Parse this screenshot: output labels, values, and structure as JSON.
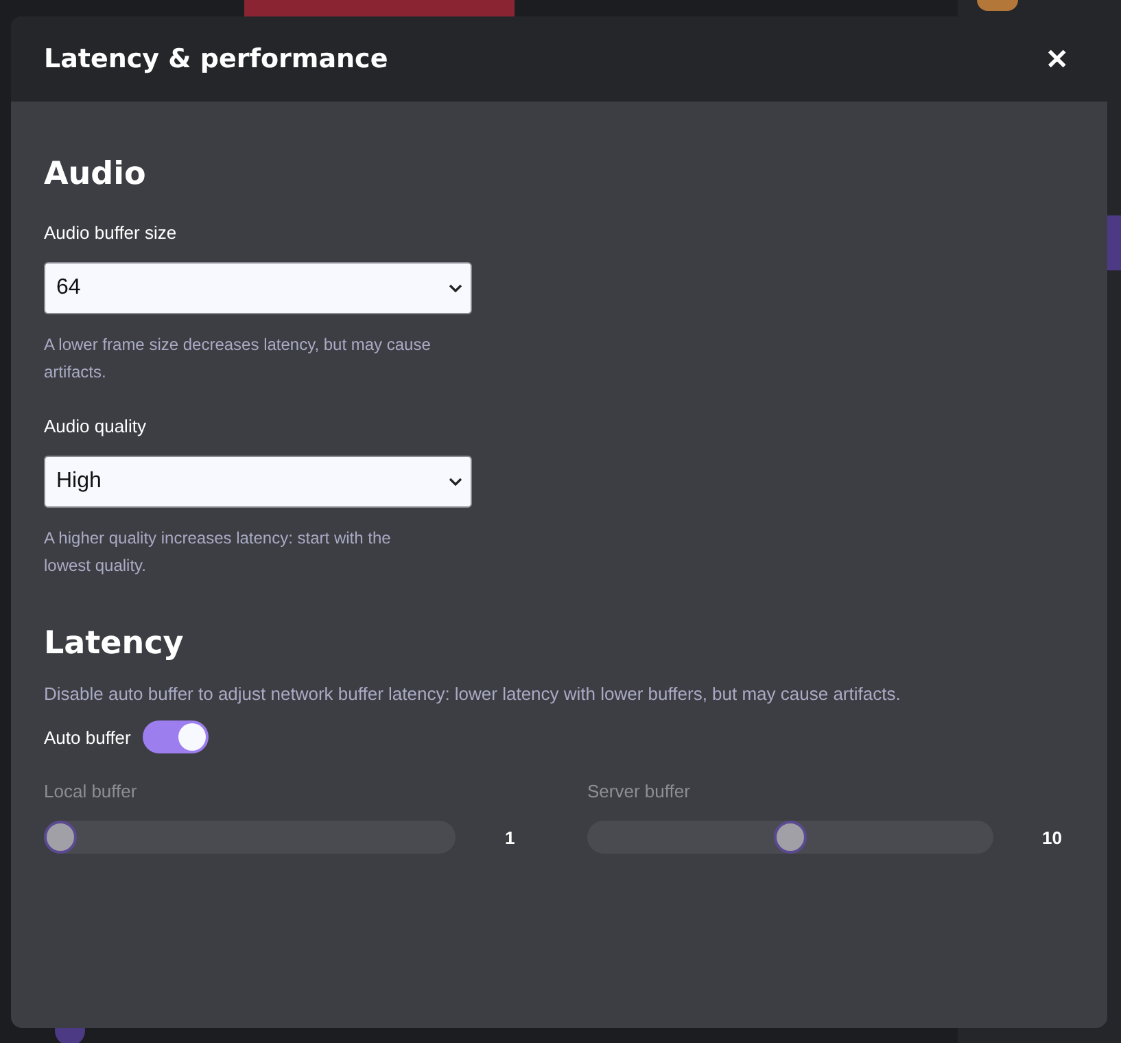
{
  "dialog": {
    "title": "Latency & performance",
    "close_label": "✕"
  },
  "sections": [
    {
      "heading": "Audio",
      "fields": [
        {
          "kind": "select",
          "label": "Audio buffer size",
          "value": "64",
          "hint": "A lower frame size decreases latency, but may cause artifacts."
        },
        {
          "kind": "select",
          "label": "Audio quality",
          "value": "High",
          "hint": "A higher quality increases latency: start with the lowest quality."
        }
      ]
    },
    {
      "heading": "Latency",
      "description": "Disable auto buffer to adjust network buffer latency: lower latency with lower buffers, but may cause artifacts.",
      "fields": [
        {
          "kind": "toggle",
          "label": "Auto buffer",
          "on": true
        }
      ],
      "sliders": [
        {
          "label": "Local buffer",
          "level": 0.0,
          "reading": "1",
          "disabled": true
        },
        {
          "label": "Server buffer",
          "level": 0.5,
          "reading": "10",
          "disabled": true
        }
      ]
    }
  ]
}
